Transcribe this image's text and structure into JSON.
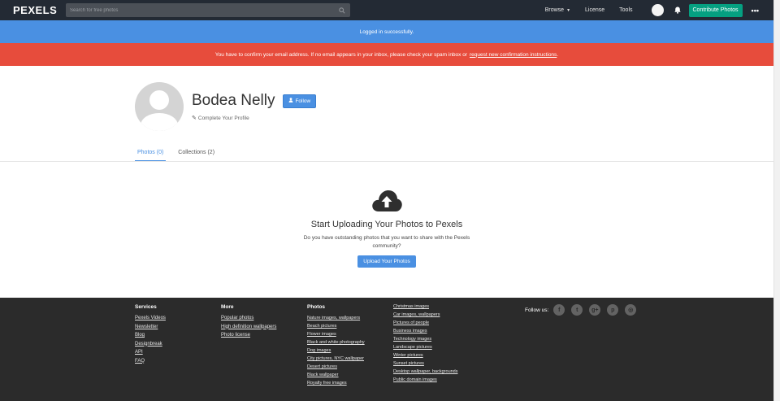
{
  "header": {
    "logo": "PEXELS",
    "search_placeholder": "Search for free photos",
    "nav": {
      "browse": "Browse",
      "license": "License",
      "tools": "Tools"
    },
    "contribute": "Contribute Photos",
    "more": "•••"
  },
  "alerts": {
    "success": "Logged in successfully.",
    "warning": "You have to confirm your email address. If no email appears in your inbox, please check your spam inbox or",
    "warning_link": "request new confirmation instructions",
    "warning_end": "."
  },
  "profile": {
    "name": "Bodea Nelly",
    "follow": "Follow",
    "complete": "Complete Your Profile"
  },
  "tabs": [
    {
      "label": "Photos (0)",
      "active": true
    },
    {
      "label": "Collections (2)",
      "active": false
    }
  ],
  "upload": {
    "title": "Start Uploading Your Photos to Pexels",
    "text": "Do you have outstanding photos that you want to share with the Pexels community?",
    "button": "Upload Your Photos"
  },
  "footer": {
    "services": {
      "title": "Services",
      "links": [
        "Pexels Videos",
        "Newsletter",
        "Blog",
        "Designbreak",
        "API",
        "FAQ"
      ]
    },
    "more": {
      "title": "More",
      "links": [
        "Popular photos",
        "High definition wallpapers",
        "Photo license"
      ]
    },
    "photos": {
      "title": "Photos",
      "links": [
        "Nature images, wallpapers",
        "Beach pictures",
        "Flower images",
        "Black and white photography",
        "Dog images",
        "City pictures, NYC wallpaper",
        "Desert pictures",
        "Black wallpaper",
        "Royalty free images"
      ]
    },
    "photos2": {
      "links": [
        "Christmas images",
        "Car images, wallpapers",
        "Pictures of people",
        "Business images",
        "Technology images",
        "Landscape pictures",
        "Winter pictures",
        "Sunset pictures",
        "Desktop wallpaper, backgrounds",
        "Public domain images"
      ]
    },
    "follow_us": "Follow us:",
    "social": [
      {
        "name": "facebook-icon",
        "glyph": "f"
      },
      {
        "name": "twitter-icon",
        "glyph": "t"
      },
      {
        "name": "google-plus-icon",
        "glyph": "g+"
      },
      {
        "name": "pinterest-icon",
        "glyph": "p"
      },
      {
        "name": "instagram-icon",
        "glyph": "◎"
      }
    ]
  },
  "colors": {
    "topbar": "#232a34",
    "blue": "#4a90e2",
    "red": "#e74c3c",
    "green": "#05a081",
    "footer": "#2b2b2b"
  }
}
